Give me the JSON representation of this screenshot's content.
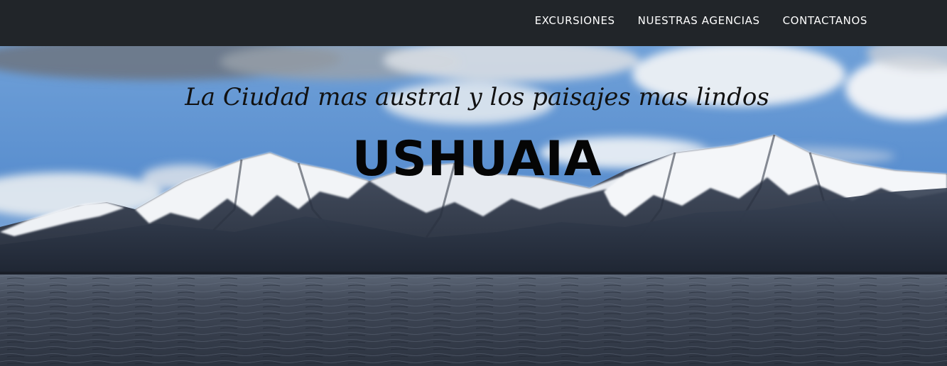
{
  "nav": {
    "items": [
      {
        "label": "EXCURSIONES"
      },
      {
        "label": "NUESTRAS AGENCIAS"
      },
      {
        "label": "CONTACTANOS"
      }
    ]
  },
  "hero": {
    "subheading": "La Ciudad mas austral y los paisajes mas lindos",
    "heading": "USHUAIA",
    "background": "mountain-lake-landscape-photo"
  },
  "colors": {
    "navbar_bg": "#212529",
    "nav_text": "#ffffff",
    "sky": "#5d93d2",
    "water": "#3a4250"
  }
}
